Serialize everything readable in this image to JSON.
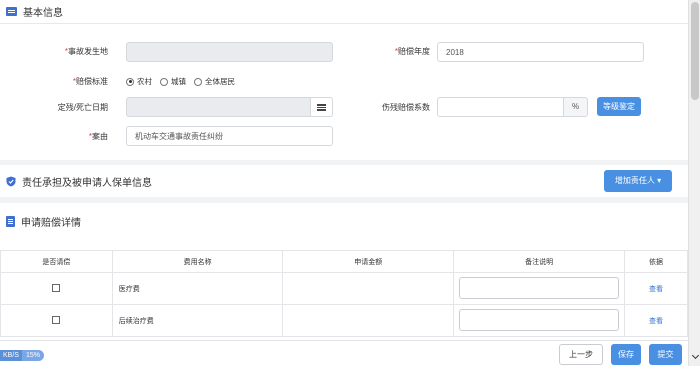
{
  "colors": {
    "accent": "#4a90e2",
    "required": "#e4393c",
    "link": "#2f6fd6",
    "section_icon": "#3f6fd1"
  },
  "basic_info": {
    "title": "基本信息",
    "accident_place_label": "事故发生地",
    "accident_place_value": "",
    "comp_year_label": "赔偿年度",
    "comp_year_value": "2018",
    "comp_standard_label": "赔偿标准",
    "comp_standard_options": [
      "农村",
      "城镇",
      "全体居民"
    ],
    "comp_standard_selected": "农村",
    "disability_date_label": "定残/死亡日期",
    "disability_date_value": "",
    "disability_coef_label": "伤残赔偿系数",
    "disability_coef_value": "",
    "percent_unit": "%",
    "grade_button": "等级鉴定",
    "cause_label": "案由",
    "cause_value": "机动车交通事故责任纠纷"
  },
  "liability": {
    "title": "责任承担及被申请人保单信息",
    "add_button": "增加责任人"
  },
  "claim": {
    "title": "申请赔偿详情",
    "columns": [
      "是否请偿",
      "费用名称",
      "申请金额",
      "备注说明",
      "依据"
    ],
    "rows": [
      {
        "fee_name": "医疗费",
        "amount": "",
        "note": "",
        "link": "查看"
      },
      {
        "fee_name": "后续治疗费",
        "amount": "",
        "note": "",
        "link": "查看"
      }
    ]
  },
  "footer": {
    "speed": "KB/S",
    "progress": "15%",
    "prev_button": "上一步",
    "save_button": "保存",
    "submit_button": "提交"
  }
}
